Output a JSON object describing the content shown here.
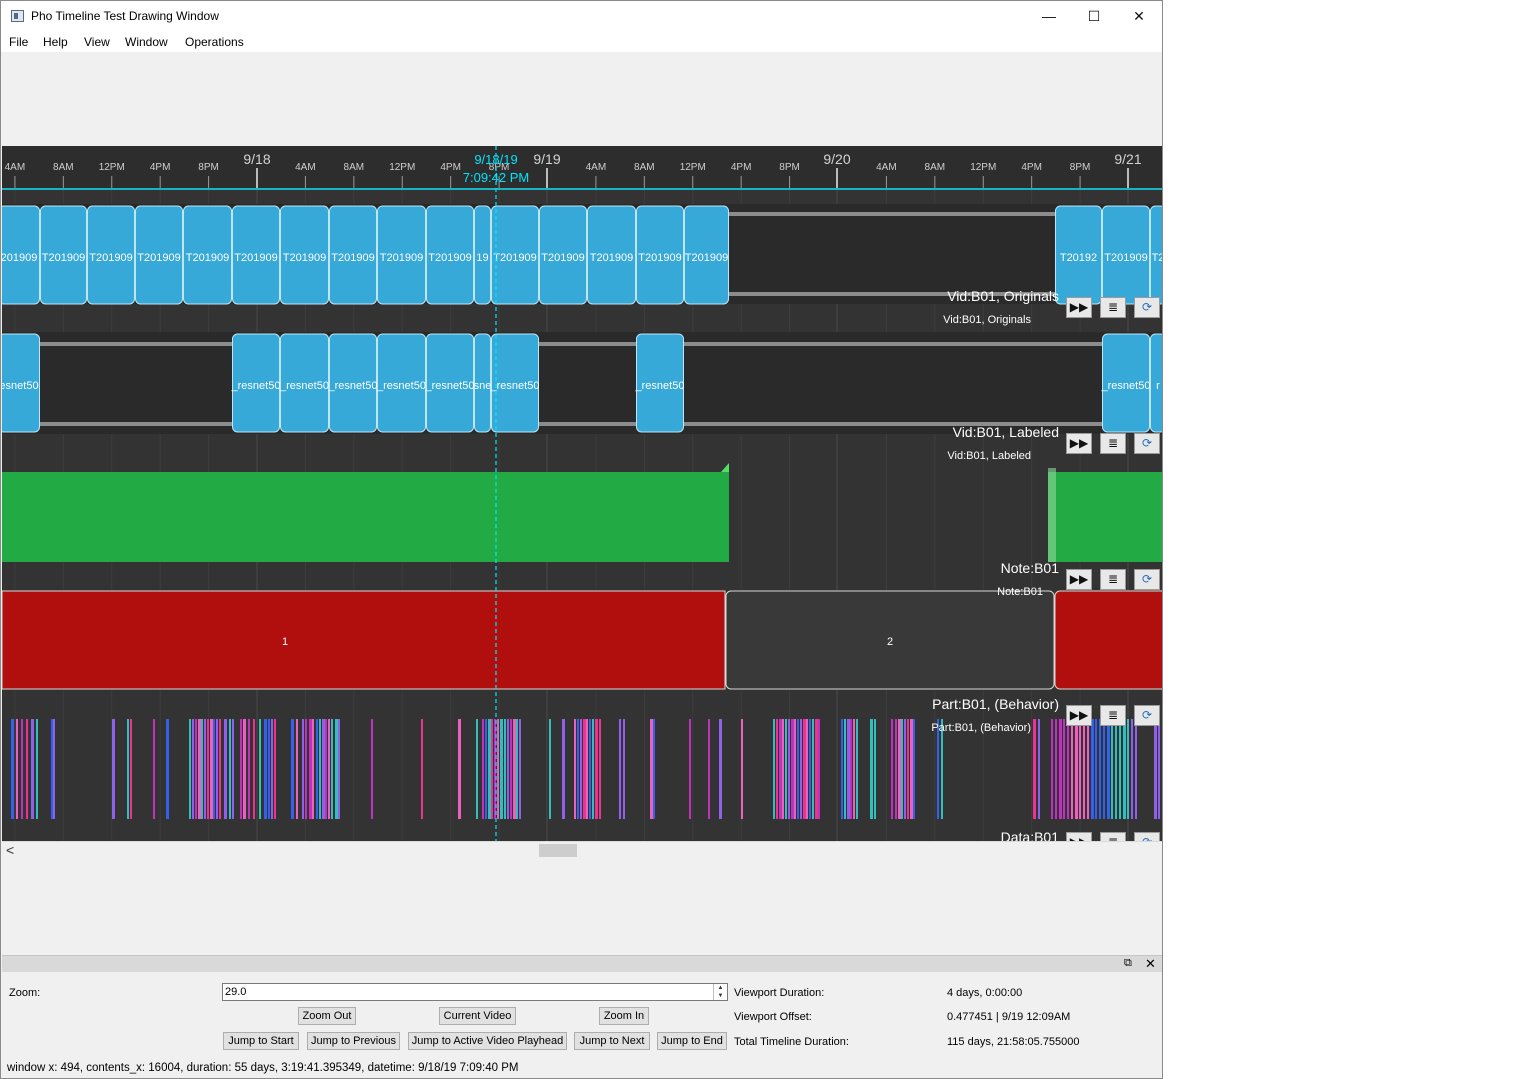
{
  "window": {
    "title": "Pho Timeline Test Drawing Window",
    "controls": {
      "minimize": "—",
      "maximize": "☐",
      "close": "✕"
    }
  },
  "menu": [
    "File",
    "Help",
    "View",
    "Window",
    "Operations"
  ],
  "timeline": {
    "hour_ticks": [
      "4AM",
      "8AM",
      "12PM",
      "4PM",
      "8PM",
      "4AM",
      "8AM",
      "12PM",
      "4PM",
      "8PM",
      "4AM",
      "8AM",
      "12PM",
      "4PM",
      "8PM",
      "4AM",
      "8AM",
      "12PM",
      "4PM",
      "8PM"
    ],
    "day_ticks": [
      "9/18",
      "9/19",
      "9/20",
      "9/21"
    ],
    "playhead": {
      "date": "9/18/19",
      "time": "7:09:42 PM",
      "color": "#00e5ff"
    },
    "tracks": [
      {
        "label": "Vid:B01, Originals",
        "sublabel": "Vid:B01, Originals",
        "color": "#36a9d8",
        "clip_text": [
          "201909",
          "T201909",
          "T201909",
          "T201909",
          "T201909",
          "T201909",
          "T201909",
          "T201909",
          "T201909",
          "T201909",
          "19",
          "T201909",
          "T201909",
          "T201909",
          "T201909",
          "T201909",
          "T20192",
          "T201909",
          "T2"
        ]
      },
      {
        "label": "Vid:B01, Labeled",
        "sublabel": "Vid:B01, Labeled",
        "color": "#36a9d8",
        "clip_text": [
          "esnet50",
          "_resnet50",
          "_resnet50",
          "_resnet50",
          "_resnet50",
          "_resnet50",
          "sne",
          "_resnet50",
          "_resnet50",
          "_resnet50",
          "r"
        ]
      },
      {
        "label": "Note:B01",
        "sublabel": "Note:B01",
        "color": "#22aa44"
      },
      {
        "label": "Part:B01, (Behavior)",
        "sublabel": "Part:B01, (Behavior)",
        "color": "#b10e0e",
        "partition_labels": [
          "1",
          "2"
        ]
      },
      {
        "label": "Data:B01",
        "sublabel": "",
        "colors": [
          "#cc33cc",
          "#ff3399",
          "#9966ff",
          "#33cccc",
          "#3366ff",
          "#ff66cc"
        ]
      }
    ],
    "track_buttons": {
      "skip_icon": "▶▶",
      "list_icon": "≣",
      "refresh_icon": "⟳"
    }
  },
  "scrollbar": {
    "left_arrow": "<"
  },
  "dock": {
    "float_icon": "⧉",
    "close_icon": "✕"
  },
  "controls": {
    "zoom_label": "Zoom:",
    "zoom_value": "29.0",
    "buttons": {
      "zoom_out": "Zoom Out",
      "current_video": "Current Video",
      "zoom_in": "Zoom In",
      "jump_start": "Jump to Start",
      "jump_previous": "Jump to Previous",
      "jump_active": "Jump to Active Video Playhead",
      "jump_next": "Jump to Next",
      "jump_end": "Jump to End"
    },
    "info": [
      {
        "label": "Viewport Duration:",
        "value": "4 days, 0:00:00"
      },
      {
        "label": "Viewport Offset:",
        "value": "0.477451 | 9/19 12:09AM"
      },
      {
        "label": "Total Timeline Duration:",
        "value": "115 days, 21:58:05.755000"
      }
    ]
  },
  "status": "window x: 494, contents_x: 16004,  duration: 55 days, 3:19:41.395349, datetime: 9/18/19 7:09:40 PM"
}
